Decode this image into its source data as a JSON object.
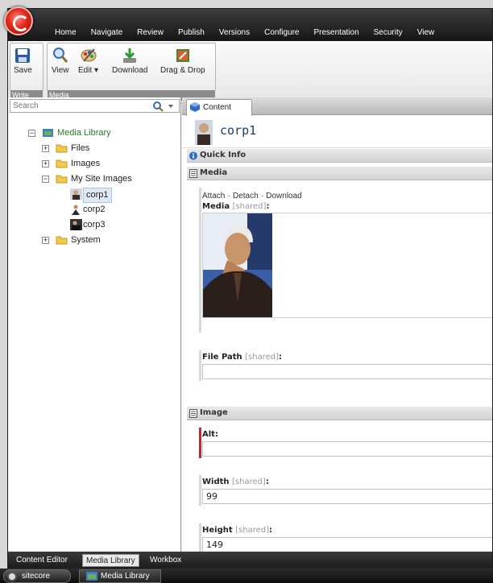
{
  "ribbon": {
    "tabs": [
      "Home",
      "Navigate",
      "Review",
      "Publish",
      "Versions",
      "Configure",
      "Presentation",
      "Security",
      "View"
    ],
    "groups": [
      {
        "label": "Write",
        "buttons": [
          "Save"
        ]
      },
      {
        "label": "Media",
        "buttons": [
          "View",
          "Edit",
          "Download",
          "Drag & Drop"
        ]
      }
    ]
  },
  "search": {
    "placeholder": "Search"
  },
  "tree": {
    "root": "Media Library",
    "files": "Files",
    "images": "Images",
    "my_site_images": "My Site Images",
    "corp1": "corp1",
    "corp2": "corp2",
    "corp3": "corp3",
    "system": "System"
  },
  "editor": {
    "tab_label": "Content",
    "item_title": "corp1",
    "quick_info": "Quick Info",
    "media_section": "Media",
    "media_links": [
      "Attach",
      "Detach",
      "Download"
    ],
    "media_field_label": "Media",
    "shared_tag": "[shared]",
    "file_path_label": "File Path",
    "file_path_value": "",
    "image_section": "Image",
    "alt_label": "Alt",
    "alt_value": "",
    "width_label": "Width",
    "width_value": "99",
    "height_label": "Height",
    "height_value": "149"
  },
  "bottom_tabs": [
    "Content Editor",
    "Media Library",
    "Workbox"
  ],
  "taskbar": {
    "start": "sitecore",
    "task": "Media Library"
  },
  "colors": {
    "accent": "#e0281a",
    "title_blue": "#1a3d73"
  }
}
